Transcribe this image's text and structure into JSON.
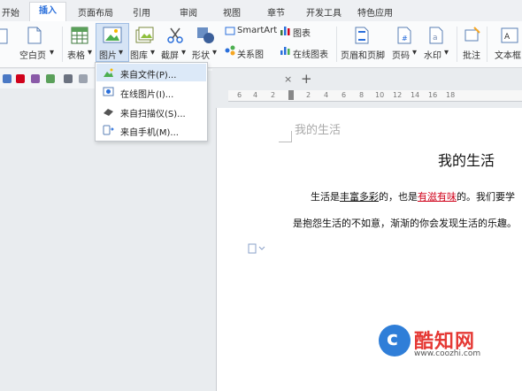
{
  "tabs": [
    {
      "label": "开始",
      "active": false
    },
    {
      "label": "插入",
      "active": true
    },
    {
      "label": "页面布局",
      "active": false
    },
    {
      "label": "引用",
      "active": false
    },
    {
      "label": "审阅",
      "active": false
    },
    {
      "label": "视图",
      "active": false
    },
    {
      "label": "章节",
      "active": false
    },
    {
      "label": "开发工具",
      "active": false
    },
    {
      "label": "特色应用",
      "active": false
    }
  ],
  "ribbon": {
    "blank_page": "空白页",
    "table": "表格",
    "picture": "图片",
    "gallery": "图库",
    "screenshot": "截屏",
    "shapes": "形状",
    "smartart": "SmartArt",
    "chart": "图表",
    "relation_map": "关系图",
    "online_chart": "在线图表",
    "header_footer": "页眉和页脚",
    "page_number": "页码",
    "watermark": "水印",
    "comment": "批注",
    "textbox": "文本框",
    "arrow": "▾"
  },
  "picture_menu": {
    "items": [
      {
        "label": "来自文件(P)...",
        "icon": "image-file-icon",
        "highlighted": true
      },
      {
        "label": "在线图片(I)...",
        "icon": "online-image-icon",
        "highlighted": false
      },
      {
        "label": "来自扫描仪(S)...",
        "icon": "scanner-icon",
        "highlighted": false
      },
      {
        "label": "来自手机(M)...",
        "icon": "phone-icon",
        "highlighted": false
      }
    ]
  },
  "doc_tab": {
    "close": "×",
    "add": "+"
  },
  "ruler": {
    "ticks": [
      "6",
      "4",
      "2",
      "",
      "2",
      "4",
      "6",
      "8",
      "10",
      "12",
      "14",
      "16",
      "18"
    ]
  },
  "document": {
    "header_text": "我的生活",
    "title": "我的生活",
    "line1_a": "生活是",
    "line1_u": "丰富多彩",
    "line1_b": "的，也是",
    "line1_r": "有滋有味",
    "line1_c": "的。我们要学",
    "line2": "是抱怨生活的不如意，渐渐的你会发现生活的乐趣。"
  },
  "watermark_logo": {
    "name": "酷知网",
    "url": "www.coozhi.com"
  },
  "colors": {
    "accent": "#2a6fdb",
    "highlight": "#dce9f8",
    "red_text": "#d0021b"
  }
}
